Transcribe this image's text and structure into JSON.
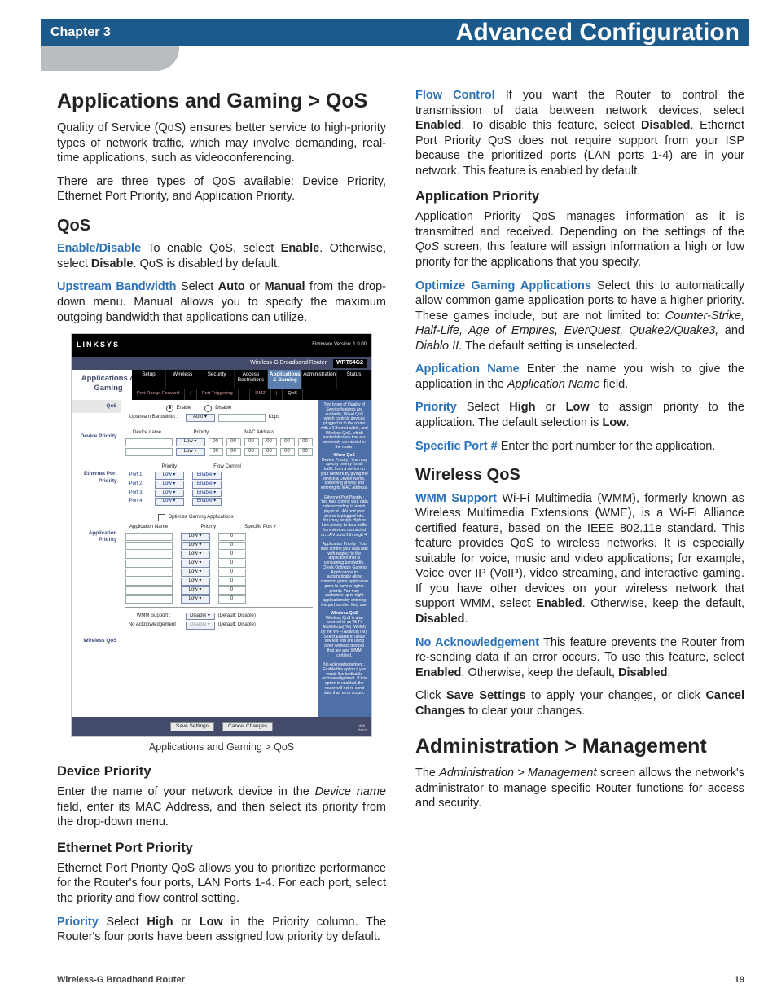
{
  "header": {
    "chapter": "Chapter 3",
    "title": "Advanced Configuration"
  },
  "left": {
    "h1_apps_gaming": "Applications and Gaming > QoS",
    "p_intro": "Quality of Service (QoS) ensures better service to high-priority types of network traffic, which may involve demanding, real-time applications, such as videoconferencing.",
    "p_types": "There are three types of QoS available: Device Priority, Ethernet Port Priority, and Application Priority.",
    "h2_qos": "QoS",
    "enable_kw": "Enable/Disable",
    "enable_txt": "  To enable QoS, select ",
    "enable_b": "Enable",
    "enable_txt2": ". Otherwise, select ",
    "disable_b": "Disable",
    "enable_txt3": ". QoS is disabled by default.",
    "up_kw": "Upstream Bandwidth",
    "up_txt": " Select ",
    "up_b1": "Auto",
    "up_or": " or ",
    "up_b2": "Manual",
    "up_txt2": " from the drop-down menu. Manual allows you to specify the maximum outgoing bandwidth that applications can utilize.",
    "figcap": "Applications and Gaming > QoS",
    "h3_devpri": "Device Priority",
    "p_devpri": "Enter the name of your network device in the ",
    "p_devpri_i": "Device name",
    "p_devpri_2": " field, enter its MAC Address, and then select its priority from the drop-down menu.",
    "h3_eth": "Ethernet Port Priority",
    "p_eth": "Ethernet Port Priority QoS allows you to prioritize performance for the Router's four ports, LAN Ports 1-4. For each port, select the priority and flow control setting."
  },
  "right": {
    "pri_kw": "Priority",
    "pri_txt": "  Select ",
    "pri_b1": "High",
    "pri_or": " or ",
    "pri_b2": "Low",
    "pri_txt2": " in the Priority column. The Router's four ports have been assigned low priority by default.",
    "fc_kw": "Flow Control",
    "fc_txt": " If you want the Router to control the transmission of data between network devices, select ",
    "fc_b1": "Enabled",
    "fc_txt2": ". To disable this feature, select ",
    "fc_b2": "Disabled",
    "fc_txt3": ". Ethernet Port Priority QoS does not require support from your ISP because the prioritized ports (LAN ports 1-4) are in your network. This feature is enabled by default.",
    "h3_appri": "Application Priority",
    "p_appri": "Application Priority QoS manages information as it is transmitted and received. Depending on the settings of the ",
    "p_appri_i": "QoS",
    "p_appri_2": " screen, this feature will assign information a high or low priority for the applications that you specify.",
    "opt_kw": "Optimize Gaming Applications",
    "opt_txt": " Select this to automatically allow common game application ports to have a higher priority. These games include, but are not limited to: ",
    "opt_games": "Counter-Strike, Half-Life, Age of Empires, EverQuest, Quake2/Quake3, ",
    "opt_and": "and ",
    "opt_lastgame": "Diablo II",
    "opt_txt2": ". The default setting is unselected.",
    "appname_kw": "Application Name",
    "appname_txt": "  Enter the name you wish to give the application in the ",
    "appname_i": "Application Name",
    "appname_txt2": " field.",
    "pri2_kw": "Priority",
    "pri2_txt": "  Select ",
    "pri2_b1": "High",
    "pri2_or": " or ",
    "pri2_b2": "Low",
    "pri2_txt2": " to assign priority to the application. The default selection is ",
    "pri2_b3": "Low",
    "pri2_dot": ".",
    "port_kw": "Specific Port #",
    "port_txt": " Enter the port number for the application.",
    "h2_wqos": "Wireless QoS",
    "wmm_kw": "WMM Support",
    "wmm_txt": " Wi-Fi Multimedia (WMM), formerly known as Wireless Multimedia Extensions (WME), is a Wi-Fi Alliance certified feature, based on the IEEE 802.11e standard. This feature provides QoS to wireless networks. It is especially suitable for voice, music and video applications; for example, Voice over IP (VoIP), video streaming, and interactive gaming. If you have other devices on your wireless network that support WMM, select ",
    "wmm_b1": "Enabled",
    "wmm_txt2": ". Otherwise, keep the default, ",
    "wmm_b2": "Disabled",
    "wmm_dot": ".",
    "noack_kw": "No Acknowledgement",
    "noack_txt": "  This feature prevents the Router from re-sending data if an error occurs. To use this feature, select ",
    "noack_b1": "Enabled",
    "noack_txt2": ". Otherwise, keep the default, ",
    "noack_b2": "Disabled",
    "noack_dot": ".",
    "save_txt": "Click ",
    "save_b1": "Save Settings",
    "save_txt2": " to apply your changes, or click ",
    "save_b2": "Cancel Changes",
    "save_txt3": " to clear your changes.",
    "h1_admin": "Administration > Management",
    "admin_txt": "The ",
    "admin_i": "Administration > Management",
    "admin_txt2": " screen allows the network's administrator to manage specific Router functions for access and security."
  },
  "router": {
    "brand": "LINKSYS",
    "fw": "Firmware Version: 1.0.00",
    "titlebar_left": "Wireless-G Broadband Router",
    "model": "WRT54G2",
    "side_title": "Applications & Gaming",
    "tabs": [
      "Setup",
      "Wireless",
      "Security",
      "Access Restrictions",
      "Applications & Gaming",
      "Administration",
      "Status"
    ],
    "subtabs": [
      "Port Range Forward",
      "Port Triggering",
      "DMZ",
      "QoS"
    ],
    "left_sections": {
      "qos": "QoS",
      "devpri": "Device Priority",
      "eth": "Ethernet Port Priority",
      "apppri": "Application Priority",
      "wqos": "Wireless QoS"
    },
    "mid": {
      "enable": "Enable",
      "disable": "Disable",
      "up_label": "Upstream Bandwidth :",
      "auto": "Auto",
      "kbps": "Kbps",
      "devname": "Device name",
      "priority": "Priority",
      "mac": "MAC Address",
      "low": "Low",
      "flowctrl": "Flow Control",
      "port1": "Port 1",
      "port2": "Port 2",
      "port3": "Port 3",
      "port4": "Port 4",
      "enable2": "Enable",
      "optchk": "Optimize Gaming Applications",
      "appname": "Application Name",
      "specport": "Specific Port #",
      "wmm": "WMM Support :",
      "noack": "No Acknowledgement :",
      "default_disable": "(Default: Disable)"
    },
    "help": {
      "p1": "Two types of Quality of Service features are available, Wired QoS which controls devices plugged in to the router with a Ethernet cable, and Wireless QoS, which control devices that are wirelessly connected to the router.",
      "h1": "Wired QoS",
      "p2": "Device Priority : You may specify priority for all traffic from a device on your network by giving the device a Device Name, specifying priority and entering its MAC address.",
      "p3": "Ethernet Port Priority : You may control your data rate according to which physical LAN port your device is plugged into. You may assign High or Low priority to data traffic from devices connected on LAN ports 1 through 4.",
      "p4": "Application Priority : You may control your data rate with respect to the application that is consuming bandwidth. Check Optimize Gaming Applications to automatically allow common game application ports to have a higher priority. You may customize up to eight applications by entering the port number they use.",
      "h2": "Wireless QoS",
      "p5": "Wireless QoS is also referred to as Wi-Fi MultiMedia(TM) (WMM) by the Wi-Fi Alliance(TM). Select Enable to utilize WMM if you are using other wireless devices that are also WMM certified.",
      "p6": "No Acknowledgement : Enable this option if you would like to disable acknowledgement. If this option is enabled, the router will not re-send data if an error occurs."
    },
    "buttons": {
      "save": "Save Settings",
      "cancel": "Cancel Changes"
    },
    "cisco": "cisco"
  },
  "footer": {
    "product": "Wireless-G Broadband Router",
    "page": "19"
  }
}
